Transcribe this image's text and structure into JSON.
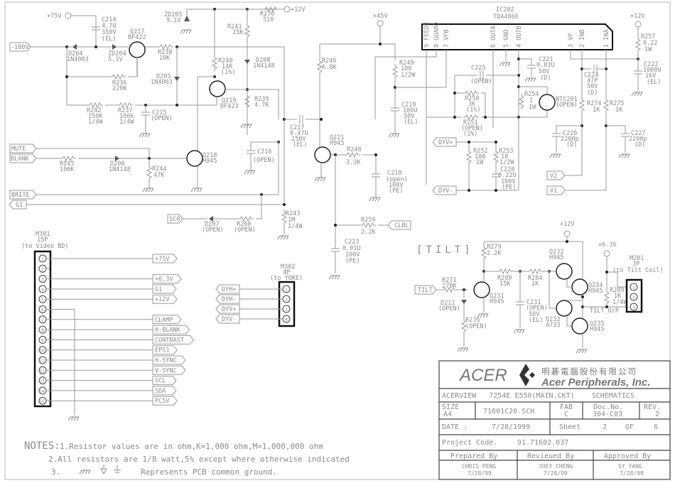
{
  "title_block": {
    "company_logo": "ACER",
    "company_chinese": "明碁電腦股份有限公司",
    "company_english": "Acer Peripherals, Inc.",
    "model_line": "ACERVIEW   7254E E550(MAIN.CKT)    SCHEMATICS",
    "size_label": "SIZE",
    "size_value": "A4",
    "filename": "71601C20.SCH",
    "fab_label": "FAB",
    "fab_value": "C",
    "doc_label": "Doc.No.",
    "doc_value": "304-C03",
    "rev_label": "REV.",
    "rev_value": "2",
    "date_label": "DATE :",
    "date_value": "7/28/1999",
    "sheet_label": "Sheet",
    "sheet_value": "2",
    "of_label": "OF",
    "of_value": "6",
    "project_label": "Project Code.",
    "project_value": "91.71602.037",
    "prepared_label": "Prepared By",
    "prepared_name": "CHRIS PENG",
    "prepared_date": "7/28/99",
    "reviewed_label": "Revieued By",
    "reviewed_name": "JOEY CHENG",
    "reviewed_date": "7/28/99",
    "approved_label": "Approved By",
    "approved_name": "SY YANG",
    "approved_date": "7/28/99"
  },
  "notes": {
    "header": "NOTES:",
    "line1": "1.Resistor values are in ohm,K=1,000 ohm,M=1,000,000 ohm",
    "line2": "2.All resistors are 1/8 watt,5% except where otherwise indicated",
    "line3_num": "3.",
    "line3_text": "Represents PCB common ground."
  },
  "section_tilt": "[TILT]",
  "ic202": {
    "ref": "IC202",
    "part": "TDA4866",
    "pins": [
      "9 FEEDB",
      "8 GUARD",
      "7 VFB",
      "6 OUTA",
      "5 GND",
      "4 OUTB",
      "3 VP",
      "2 INB",
      "1 INA"
    ]
  },
  "power": {
    "p75": "+75V",
    "p12a": "+12V",
    "p45": "+45V",
    "p12b": "+12V",
    "p12c": "+12V",
    "p63": "+6.3V"
  },
  "ports": {
    "m180": "-180V",
    "mute": "MUTE",
    "blank": "BLANK",
    "brite": "BRITE",
    "g1": "G1",
    "sc0": "SC0",
    "clbl": "CLBL",
    "dyvp": "DYV+",
    "dyvm": "DYV-",
    "v2": "V2",
    "v1": "V1",
    "tilt": "TILT",
    "tilt_op": "TILT_O/P"
  },
  "m301": {
    "ref": "M301",
    "pins_count": "15P",
    "dest": "(to Video BD)",
    "pins": [
      "1",
      "2",
      "3",
      "4",
      "5",
      "6",
      "7",
      "8",
      "9",
      "10",
      "11",
      "12",
      "13",
      "14",
      "15"
    ],
    "signals": [
      "+75V",
      "",
      "+6.3V",
      "G1",
      "+12V",
      "",
      "CLAMP",
      "H-BLANK",
      "CONTRAST",
      "EPS1",
      "H-SYNC",
      "V-SYNC",
      "SCL",
      "SDA",
      "PC5V"
    ]
  },
  "m302": {
    "ref": "M302",
    "pins_count": "4P",
    "dest": "(to YOKE)",
    "pins": [
      "1",
      "2",
      "3",
      "4"
    ],
    "signals": [
      "DYH+",
      "DYH-",
      "DYV+",
      "DYV-"
    ]
  },
  "m201": {
    "ref": "M201",
    "pins_count": "3P",
    "dest": "(to Tilt Coil)",
    "pins": [
      "1",
      "2",
      "3"
    ]
  },
  "components": {
    "c214": [
      "C214",
      "4.7U",
      "350V",
      "(EL)"
    ],
    "q217": [
      "Q217",
      "BF422"
    ],
    "zd205": [
      "ZD205",
      "9.1V"
    ],
    "r270": [
      "R270",
      "510"
    ],
    "r241": [
      "R241",
      "15K"
    ],
    "d204": [
      "D204",
      "1N4003"
    ],
    "zd204": [
      "ZD204",
      "5.1V"
    ],
    "r238": [
      "R238",
      "10K"
    ],
    "r240": [
      "R240",
      "14K",
      "(1%)"
    ],
    "d208": [
      "D208",
      "1N4148"
    ],
    "d205": [
      "D205",
      "1N4003"
    ],
    "r236": [
      "R236",
      "220K"
    ],
    "q219": [
      "Q219",
      "BF423"
    ],
    "r239": [
      "R239",
      "4.7K"
    ],
    "r242": [
      "R242",
      "150K",
      "1/4W"
    ],
    "r237": [
      "R237",
      "100k",
      "1/4W"
    ],
    "c215": [
      "C215",
      "(OPEN)"
    ],
    "c217": [
      "C217",
      "0.47U",
      "250V",
      "(EL)"
    ],
    "c216": [
      "C216",
      "(OPEN)"
    ],
    "r245": [
      "R245",
      "100K"
    ],
    "d206": [
      "D206",
      "1N4148"
    ],
    "r244": [
      "R244",
      "47K"
    ],
    "q218": [
      "Q218",
      "H945"
    ],
    "d207": [
      "D207",
      "(OPEN)"
    ],
    "r260": [
      "R260",
      "(OPEN)"
    ],
    "r243": [
      "R243",
      "1M",
      "1/4W"
    ],
    "r246": [
      "R246",
      "6.8K"
    ],
    "r249": [
      "R249",
      "100",
      "1/2W"
    ],
    "c219": [
      "C219",
      "100U",
      "50V",
      "(EL)"
    ],
    "q221": [
      "Q221",
      "H945"
    ],
    "r248": [
      "R248",
      "3.3K"
    ],
    "c218": [
      "C218",
      "(open)",
      "100V",
      "(PE)"
    ],
    "r259": [
      "R259",
      "2.2K"
    ],
    "c223": [
      "C223",
      "0.01U",
      "100V",
      "(PE)"
    ],
    "c225": [
      "C225",
      "(OPEN)"
    ],
    "c221": [
      "C221",
      "0.01U",
      "50V",
      "(D)"
    ],
    "r250": [
      "R250",
      "3K",
      "(1%)"
    ],
    "r251": [
      "R251",
      "(OPEN)",
      "(1%)"
    ],
    "r254": [
      "R254",
      "1",
      "1W"
    ],
    "ntc201": [
      "NTC201",
      "(OPEN)"
    ],
    "r252": [
      "R252",
      "180",
      "1W"
    ],
    "r253": [
      "R253",
      "10",
      "1/2W"
    ],
    "c220": [
      "C220",
      "0.22U",
      "100V",
      "(PE)"
    ],
    "c224": [
      "C224",
      "47P",
      "50V",
      "(D)"
    ],
    "r257": [
      "R257",
      "0.22",
      "1W"
    ],
    "c222": [
      "C222",
      "1000U",
      "16V",
      "(EL)"
    ],
    "r274": [
      "R274",
      "1K"
    ],
    "r275": [
      "R275",
      "1K"
    ],
    "c226": [
      "C226",
      "2200p",
      "(D)"
    ],
    "c227": [
      "C227",
      "2200p",
      "(D)"
    ],
    "r279": [
      "R279",
      "2.2K"
    ],
    "r271": [
      "R271",
      "270K"
    ],
    "r280": [
      "R280",
      "15K"
    ],
    "r284": [
      "R284",
      "1K"
    ],
    "q232": [
      "Q232",
      "H945"
    ],
    "q234": [
      "Q234",
      "H945"
    ],
    "q231": [
      "Q231",
      "H945"
    ],
    "d211": [
      "D211",
      "(OPEN)"
    ],
    "r276": [
      "R276",
      "(OPEN)"
    ],
    "c231": [
      "C231",
      "(OPEN)",
      "50V",
      "(EL)"
    ],
    "q233": [
      "Q233",
      "A733"
    ],
    "q235": [
      "Q235",
      "H945"
    ],
    "r289": [
      "R289",
      "1K",
      "1/4W"
    ]
  }
}
